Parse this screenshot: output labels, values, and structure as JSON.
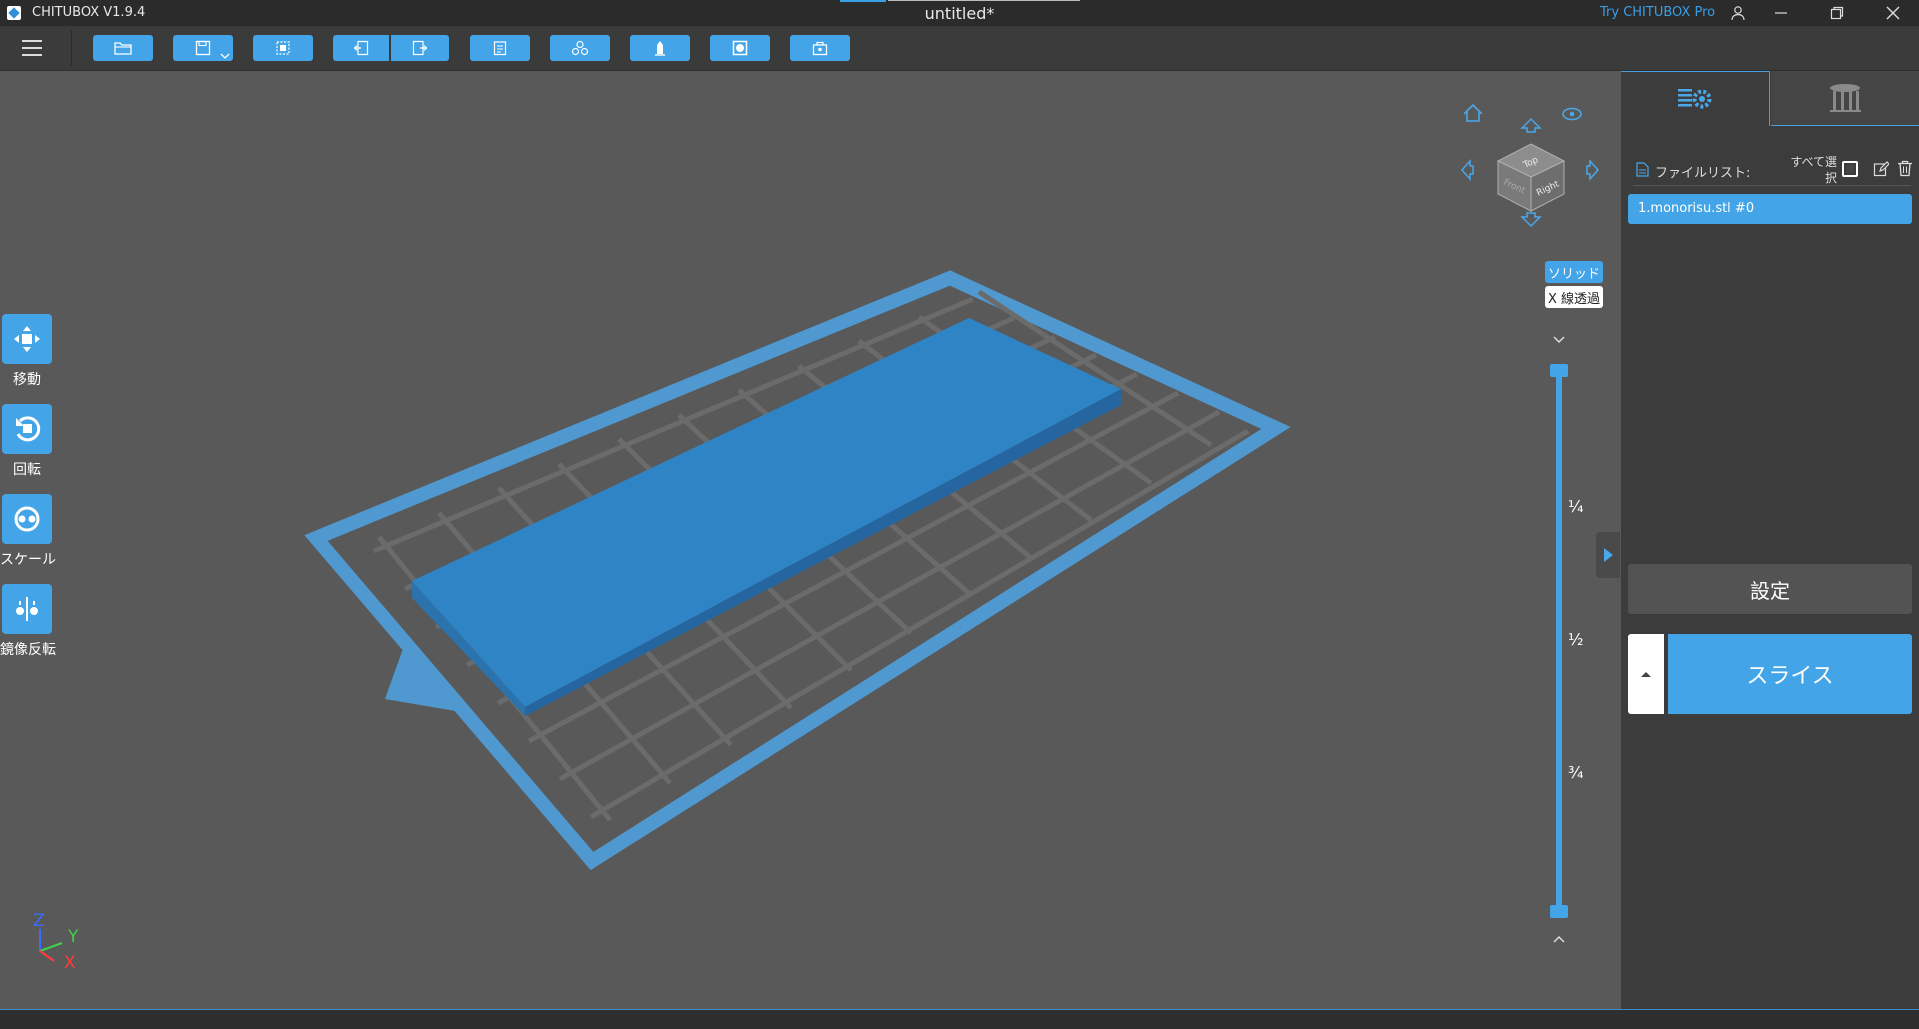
{
  "app": {
    "name": "CHITUBOX V1.9.4",
    "document_title": "untitled*",
    "pro_link": "Try CHITUBOX Pro",
    "accent_color": "#43a5e8"
  },
  "window_controls": [
    "user-icon",
    "minimize-icon",
    "restore-icon",
    "close-icon"
  ],
  "toolbar": {
    "buttons": [
      {
        "name": "open-file",
        "icon": "folder-icon"
      },
      {
        "name": "save",
        "icon": "save-icon",
        "has_dropdown": true
      },
      {
        "name": "select",
        "icon": "select-box-icon"
      },
      {
        "name": "undo",
        "icon": "undo-icon"
      },
      {
        "name": "redo",
        "icon": "redo-icon"
      },
      {
        "name": "clipboard",
        "icon": "clipboard-icon"
      },
      {
        "name": "auto-layout",
        "icon": "layout-icon"
      },
      {
        "name": "support",
        "icon": "support-icon"
      },
      {
        "name": "hollow",
        "icon": "hollow-icon"
      },
      {
        "name": "drill",
        "icon": "drill-icon"
      }
    ]
  },
  "left_tools": [
    {
      "id": "move",
      "label": "移動",
      "icon": "move-icon"
    },
    {
      "id": "rotate",
      "label": "回転",
      "icon": "rotate-icon"
    },
    {
      "id": "scale",
      "label": "スケール",
      "icon": "scale-icon"
    },
    {
      "id": "mirror",
      "label": "鏡像反転",
      "icon": "mirror-icon"
    }
  ],
  "view_cube": {
    "faces": [
      "Top",
      "Right",
      "Front"
    ]
  },
  "render_mode": {
    "solid": "ソリッド",
    "xray": "X 線透過",
    "active": "solid"
  },
  "layer_slider": {
    "ticks": [
      "¼",
      "½",
      "¾"
    ],
    "top_value": 1,
    "bottom_value": 0
  },
  "axes": {
    "z": "Z",
    "y": "Y",
    "x": "X"
  },
  "right_panel": {
    "tabs": [
      {
        "icon": "file-settings-icon",
        "active": true
      },
      {
        "icon": "supports-icon",
        "active": false
      }
    ],
    "file_list": {
      "label": "ファイルリスト:",
      "select_all": "すべて選択",
      "select_all_line1": "すべて選",
      "select_all_line2": "択",
      "files": [
        "1.monorisu.stl #0"
      ]
    },
    "settings_button": "設定",
    "slice_button": "スライス"
  }
}
